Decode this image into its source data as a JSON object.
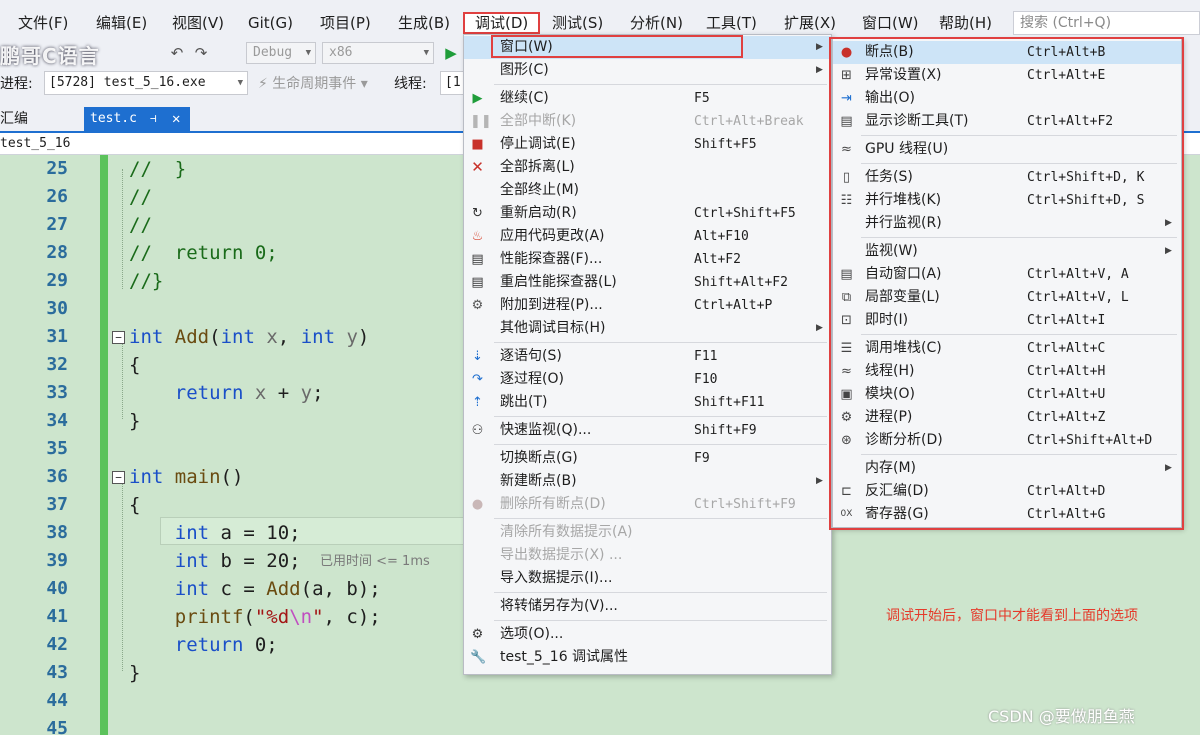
{
  "watermark_title": "鹏哥C语言",
  "menubar": [
    "文件(F)",
    "编辑(E)",
    "视图(V)",
    "Git(G)",
    "项目(P)",
    "生成(B)",
    "调试(D)",
    "测试(S)",
    "分析(N)",
    "工具(T)",
    "扩展(X)",
    "窗口(W)",
    "帮助(H)"
  ],
  "search_placeholder": "搜索 (Ctrl+Q)",
  "toolbar": {
    "config": "Debug",
    "platform": "x86"
  },
  "process": {
    "process_label": "进程:",
    "process_value": "[5728] test_5_16.exe",
    "lifecycle_label": "生命周期事件",
    "thread_label": "线程:",
    "thread_value": "[1"
  },
  "tabs": {
    "other": "汇编",
    "active": "test.c"
  },
  "file_scope": "test_5_16",
  "editor": {
    "line_numbers": [
      "25",
      "26",
      "27",
      "28",
      "29",
      "30",
      "31",
      "32",
      "33",
      "34",
      "35",
      "36",
      "37",
      "38",
      "39",
      "40",
      "41",
      "42",
      "43",
      "44",
      "45"
    ],
    "elapsed_hint": "已用时间 <= 1ms"
  },
  "debug_menu": {
    "items": [
      {
        "label": "窗口(W)",
        "shortcut": "",
        "icon": "",
        "submenu": true
      },
      {
        "label": "图形(C)",
        "shortcut": "",
        "icon": "",
        "submenu": true
      },
      {
        "label": "继续(C)",
        "shortcut": "F5",
        "icon": "play-icon"
      },
      {
        "label": "全部中断(K)",
        "shortcut": "Ctrl+Alt+Break",
        "icon": "pause-icon",
        "disabled": true
      },
      {
        "label": "停止调试(E)",
        "shortcut": "Shift+F5",
        "icon": "stop-icon"
      },
      {
        "label": "全部拆离(L)",
        "shortcut": "",
        "icon": "detach-icon"
      },
      {
        "label": "全部终止(M)",
        "shortcut": "",
        "icon": ""
      },
      {
        "label": "重新启动(R)",
        "shortcut": "Ctrl+Shift+F5",
        "icon": "restart-icon"
      },
      {
        "label": "应用代码更改(A)",
        "shortcut": "Alt+F10",
        "icon": "hot-reload-icon"
      },
      {
        "label": "性能探查器(F)...",
        "shortcut": "Alt+F2",
        "icon": "profiler-icon"
      },
      {
        "label": "重启性能探查器(L)",
        "shortcut": "Shift+Alt+F2",
        "icon": "profiler-restart-icon"
      },
      {
        "label": "附加到进程(P)...",
        "shortcut": "Ctrl+Alt+P",
        "icon": "attach-icon"
      },
      {
        "label": "其他调试目标(H)",
        "shortcut": "",
        "icon": "",
        "submenu": true
      },
      {
        "label": "逐语句(S)",
        "shortcut": "F11",
        "icon": "step-into-icon"
      },
      {
        "label": "逐过程(O)",
        "shortcut": "F10",
        "icon": "step-over-icon"
      },
      {
        "label": "跳出(T)",
        "shortcut": "Shift+F11",
        "icon": "step-out-icon"
      },
      {
        "label": "快速监视(Q)...",
        "shortcut": "Shift+F9",
        "icon": "quickwatch-icon"
      },
      {
        "label": "切换断点(G)",
        "shortcut": "F9",
        "icon": ""
      },
      {
        "label": "新建断点(B)",
        "shortcut": "",
        "icon": "",
        "submenu": true
      },
      {
        "label": "删除所有断点(D)",
        "shortcut": "Ctrl+Shift+F9",
        "icon": "delete-breakpoints-icon",
        "disabled": true
      },
      {
        "label": "清除所有数据提示(A)",
        "shortcut": "",
        "icon": "",
        "disabled": true
      },
      {
        "label": "导出数据提示(X) ...",
        "shortcut": "",
        "icon": "",
        "disabled": true
      },
      {
        "label": "导入数据提示(I)...",
        "shortcut": "",
        "icon": ""
      },
      {
        "label": "将转储另存为(V)...",
        "shortcut": "",
        "icon": ""
      },
      {
        "label": "选项(O)...",
        "shortcut": "",
        "icon": "gear-icon"
      },
      {
        "label": "test_5_16 调试属性",
        "shortcut": "",
        "icon": "wrench-icon"
      }
    ]
  },
  "window_submenu": {
    "items": [
      {
        "label": "断点(B)",
        "shortcut": "Ctrl+Alt+B",
        "icon": "breakpoint-icon"
      },
      {
        "label": "异常设置(X)",
        "shortcut": "Ctrl+Alt+E",
        "icon": "exception-icon"
      },
      {
        "label": "输出(O)",
        "shortcut": "",
        "icon": "output-icon"
      },
      {
        "label": "显示诊断工具(T)",
        "shortcut": "Ctrl+Alt+F2",
        "icon": "diagnostics-icon"
      },
      {
        "label": "GPU 线程(U)",
        "shortcut": "",
        "icon": "gpu-threads-icon"
      },
      {
        "label": "任务(S)",
        "shortcut": "Ctrl+Shift+D, K",
        "icon": "tasks-icon"
      },
      {
        "label": "并行堆栈(K)",
        "shortcut": "Ctrl+Shift+D, S",
        "icon": "parallel-stacks-icon"
      },
      {
        "label": "并行监视(R)",
        "shortcut": "",
        "icon": "",
        "submenu": true
      },
      {
        "label": "监视(W)",
        "shortcut": "",
        "icon": "",
        "submenu": true
      },
      {
        "label": "自动窗口(A)",
        "shortcut": "Ctrl+Alt+V, A",
        "icon": "autos-icon"
      },
      {
        "label": "局部变量(L)",
        "shortcut": "Ctrl+Alt+V, L",
        "icon": "locals-icon"
      },
      {
        "label": "即时(I)",
        "shortcut": "Ctrl+Alt+I",
        "icon": "immediate-icon"
      },
      {
        "label": "调用堆栈(C)",
        "shortcut": "Ctrl+Alt+C",
        "icon": "callstack-icon"
      },
      {
        "label": "线程(H)",
        "shortcut": "Ctrl+Alt+H",
        "icon": "threads-icon"
      },
      {
        "label": "模块(O)",
        "shortcut": "Ctrl+Alt+U",
        "icon": "modules-icon"
      },
      {
        "label": "进程(P)",
        "shortcut": "Ctrl+Alt+Z",
        "icon": "processes-icon"
      },
      {
        "label": "诊断分析(D)",
        "shortcut": "Ctrl+Shift+Alt+D",
        "icon": "diag-analysis-icon"
      },
      {
        "label": "内存(M)",
        "shortcut": "",
        "icon": "",
        "submenu": true
      },
      {
        "label": "反汇编(D)",
        "shortcut": "Ctrl+Alt+D",
        "icon": "disassembly-icon"
      },
      {
        "label": "寄存器(G)",
        "shortcut": "Ctrl+Alt+G",
        "icon": "registers-icon"
      }
    ]
  },
  "annotation_note": "调试开始后，窗口中才能看到上面的选项",
  "csdn_watermark": "CSDN @要做朋鱼燕",
  "colors": {
    "highlight_box": "#e04040",
    "editor_bg": "#cde5cd",
    "tab_active": "#1e6fd0",
    "note_text": "#e53a2a"
  }
}
